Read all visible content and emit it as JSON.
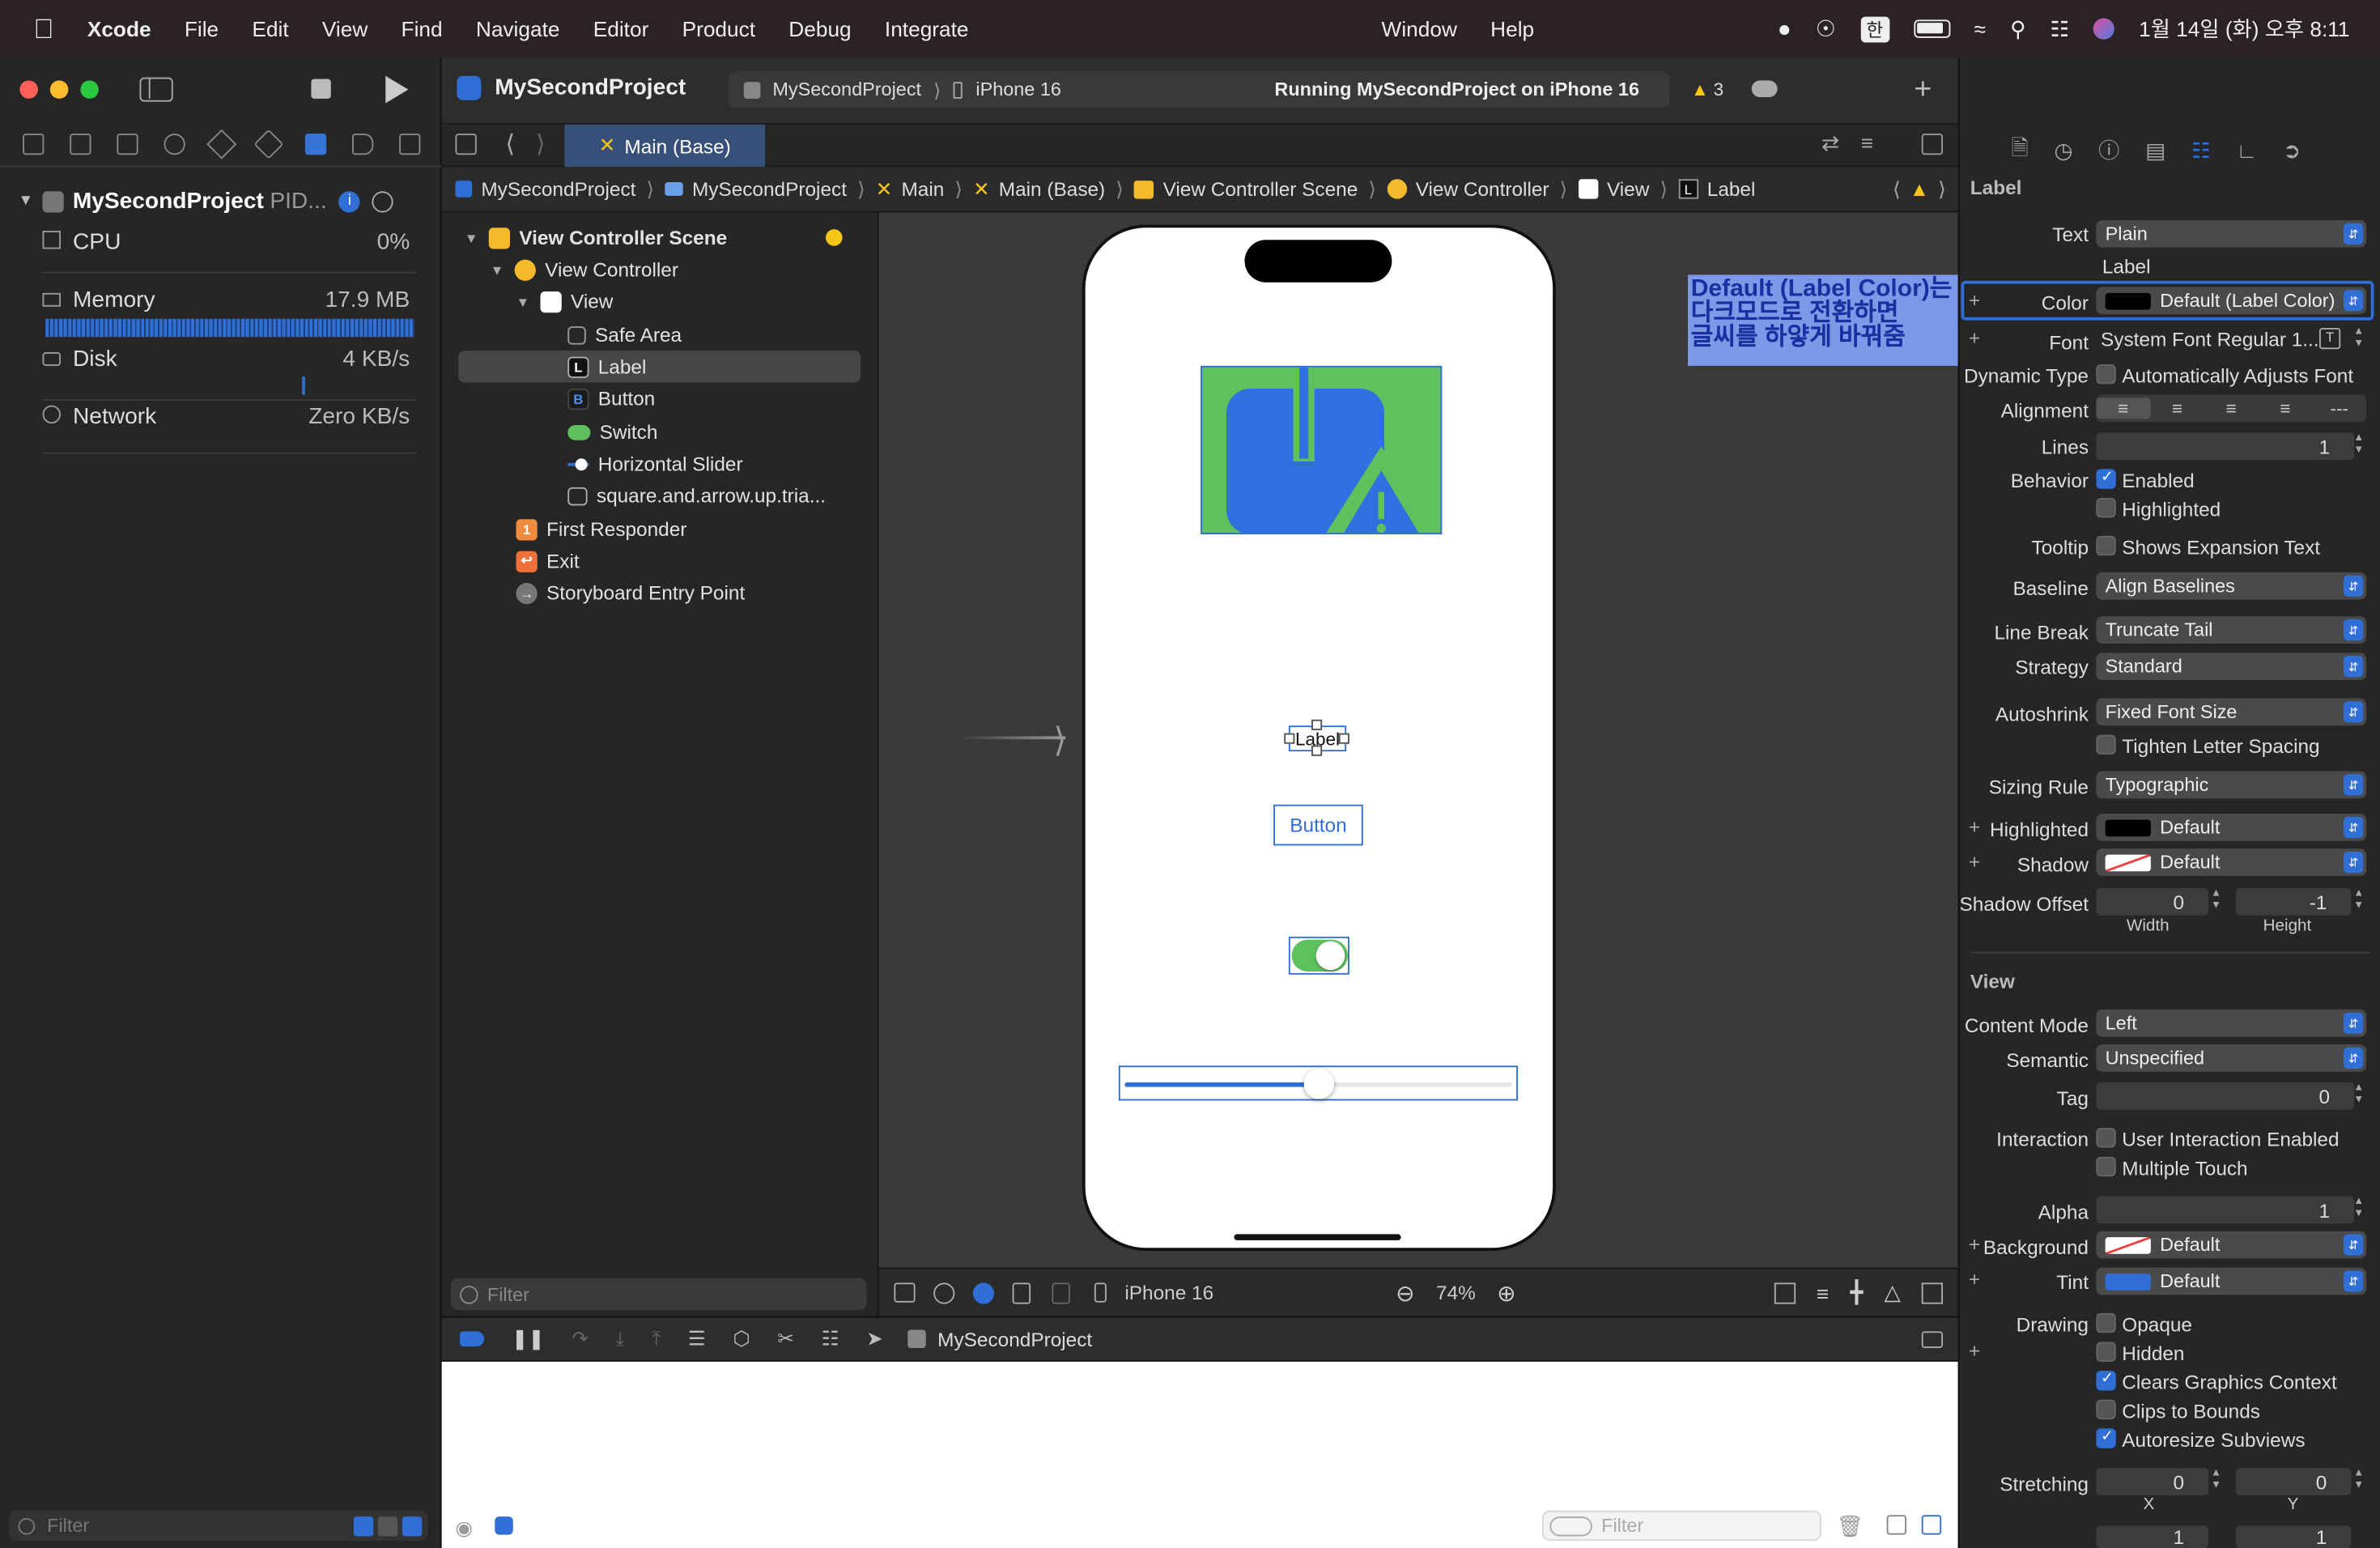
{
  "menubar": {
    "app": "Xcode",
    "items": [
      "File",
      "Edit",
      "View",
      "Find",
      "Navigate",
      "Editor",
      "Product",
      "Debug",
      "Integrate"
    ],
    "right_items": [
      "Window",
      "Help"
    ],
    "ime": "한",
    "clock": "1월 14일 (화) 오후 8:11"
  },
  "navigator": {
    "process": "MySecondProject",
    "process_suffix": "PID...",
    "gauges": [
      {
        "name": "CPU",
        "value": "0%"
      },
      {
        "name": "Memory",
        "value": "17.9 MB"
      },
      {
        "name": "Disk",
        "value": "4 KB/s"
      },
      {
        "name": "Network",
        "value": "Zero KB/s"
      }
    ],
    "filter_placeholder": "Filter"
  },
  "toolbar": {
    "project": "MySecondProject",
    "scheme": "MySecondProject",
    "device": "iPhone 16",
    "status": "Running MySecondProject on iPhone 16",
    "warnings": "3"
  },
  "tab": {
    "label": "Main (Base)"
  },
  "jumpbar": [
    "MySecondProject",
    "MySecondProject",
    "Main",
    "Main (Base)",
    "View Controller Scene",
    "View Controller",
    "View",
    "Label"
  ],
  "outline": {
    "rows": [
      {
        "label": "View Controller Scene",
        "bold": true
      },
      {
        "label": "View Controller"
      },
      {
        "label": "View"
      },
      {
        "label": "Safe Area"
      },
      {
        "label": "Label"
      },
      {
        "label": "Button"
      },
      {
        "label": "Switch"
      },
      {
        "label": "Horizontal Slider"
      },
      {
        "label": "square.and.arrow.up.tria..."
      },
      {
        "label": "First Responder"
      },
      {
        "label": "Exit"
      },
      {
        "label": "Storyboard Entry Point"
      }
    ],
    "filter_placeholder": "Filter"
  },
  "canvas": {
    "label_text": "Label",
    "button_text": "Button",
    "switch_on": true,
    "slider_value": 0.5,
    "device": "iPhone 16",
    "zoom": "74%"
  },
  "debug": {
    "target": "MySecondProject",
    "filter_placeholder": "Filter"
  },
  "annotation": {
    "line1": "Default (Label Color)는",
    "line2": "다크모드로 전환하면",
    "line3": "글씨를 하얗게 바꿔줌"
  },
  "inspector": {
    "section_label": "Label",
    "text_label": "Text",
    "text_value": "Plain",
    "text_content": "Label",
    "color_label": "Color",
    "color_value": "Default (Label Color)",
    "font_label": "Font",
    "font_value": "System Font Regular 1...",
    "dynamic_label": "Dynamic Type",
    "dynamic_value": "Automatically Adjusts Font",
    "alignment_label": "Alignment",
    "lines_label": "Lines",
    "lines_value": "1",
    "behavior_label": "Behavior",
    "enabled": "Enabled",
    "highlighted_cb": "Highlighted",
    "tooltip_label": "Tooltip",
    "tooltip_value": "Shows Expansion Text",
    "baseline_label": "Baseline",
    "baseline_value": "Align Baselines",
    "linebreak_label": "Line Break",
    "linebreak_value": "Truncate Tail",
    "strategy_label": "Strategy",
    "strategy_value": "Standard",
    "autoshrink_label": "Autoshrink",
    "autoshrink_value": "Fixed Font Size",
    "tighten": "Tighten Letter Spacing",
    "sizing_label": "Sizing Rule",
    "sizing_value": "Typographic",
    "highlighted_label": "Highlighted",
    "highlighted_value": "Default",
    "shadow_label": "Shadow",
    "shadow_value": "Default",
    "shadowoffset_label": "Shadow Offset",
    "shadow_w": "0",
    "shadow_h": "-1",
    "width_label": "Width",
    "height_label": "Height",
    "view_section": "View",
    "content_mode_label": "Content Mode",
    "content_mode_value": "Left",
    "semantic_label": "Semantic",
    "semantic_value": "Unspecified",
    "tag_label": "Tag",
    "tag_value": "0",
    "interaction_label": "Interaction",
    "user_interaction": "User Interaction Enabled",
    "multiple_touch": "Multiple Touch",
    "alpha_label": "Alpha",
    "alpha_value": "1",
    "background_label": "Background",
    "background_value": "Default",
    "tint_label": "Tint",
    "tint_value": "Default",
    "drawing_label": "Drawing",
    "opaque": "Opaque",
    "hidden": "Hidden",
    "clears": "Clears Graphics Context",
    "clips": "Clips to Bounds",
    "autoresize": "Autoresize Subviews",
    "stretching_label": "Stretching",
    "stretch_x": "0",
    "stretch_y": "0",
    "x_label": "X",
    "y_label": "Y",
    "stretch_w": "1",
    "stretch_h": "1"
  },
  "colors": {
    "accent": "#2f6fd6",
    "image_bg": "#5ec15e",
    "symbol_blue": "#2f6fe0",
    "annotation_bg": "#6b8ce6"
  }
}
